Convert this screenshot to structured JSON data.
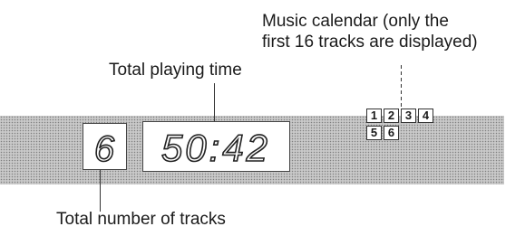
{
  "labels": {
    "music_calendar_line1": "Music calendar (only the",
    "music_calendar_line2": "first 16 tracks are displayed)",
    "total_playing_time": "Total playing time",
    "total_tracks": "Total number of tracks"
  },
  "display": {
    "track_count": "6",
    "playing_time": "50:42",
    "calendar_tracks": [
      "1",
      "2",
      "3",
      "4",
      "5",
      "6"
    ]
  }
}
